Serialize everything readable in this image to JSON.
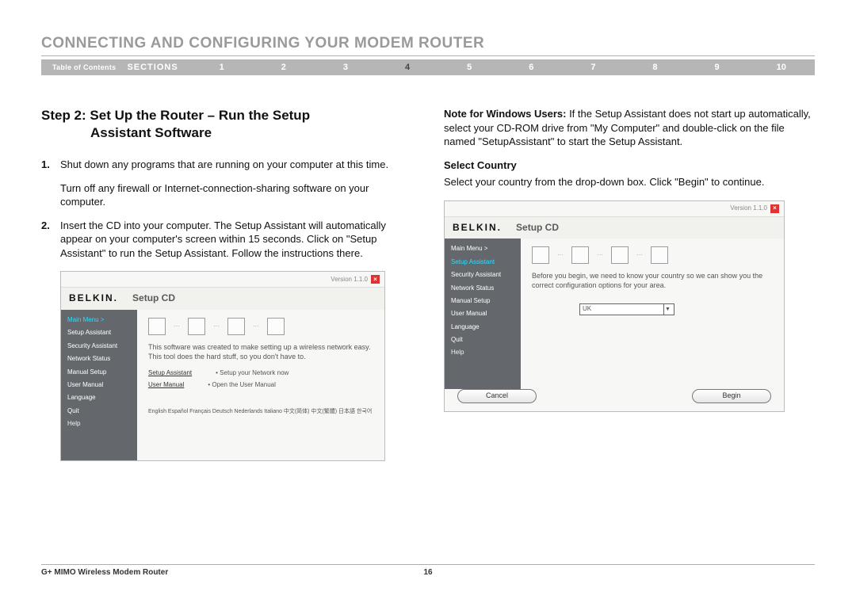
{
  "doc_title": "CONNECTING AND CONFIGURING YOUR MODEM ROUTER",
  "nav": {
    "toc": "Table of Contents",
    "sections": "SECTIONS",
    "numbers": [
      "1",
      "2",
      "3",
      "4",
      "5",
      "6",
      "7",
      "8",
      "9",
      "10"
    ],
    "active": "4"
  },
  "step": {
    "line1": "Step 2: Set Up the Router – Run the Setup",
    "line2": "Assistant Software"
  },
  "list": {
    "n1": "1.",
    "t1": "Shut down any programs that are running on your computer at this time.",
    "sub1": "Turn off any firewall or Internet-connection-sharing software on your computer.",
    "n2": "2.",
    "t2": "Insert the CD into your computer. The Setup Assistant will automatically appear on your computer's screen within 15 seconds. Click on \"Setup Assistant\" to run the Setup Assistant. Follow the instructions there."
  },
  "right": {
    "note_label": "Note for Windows Users:",
    "note_text": " If the Setup Assistant does not start up automatically, select your CD-ROM drive from \"My Computer\" and double-click on the file named \"SetupAssistant\" to start the Setup Assistant.",
    "sc_title": "Select Country",
    "sc_text": "Select your country from the drop-down box. Click \"Begin\" to continue."
  },
  "shotA": {
    "version": "Version 1.1.0",
    "brand": "BELKIN",
    "subhdr": "Setup CD",
    "menu": [
      "Main Menu  >",
      "Setup Assistant",
      "Security Assistant",
      "Network Status",
      "Manual Setup",
      "User Manual",
      "Language",
      "Quit"
    ],
    "highlight": 0,
    "help": "Help",
    "desc": "This software was created to make setting up a wireless network easy. This tool does the hard stuff, so you don't have to.",
    "link1a": "Setup Assistant",
    "link1b": "• Setup your Network now",
    "link2a": "User Manual",
    "link2b": "• Open the User Manual",
    "langs": "English  Español  Français  Deutsch  Nederlands  Italiano  中文(简体)  中文(繁體)  日本語  한국어"
  },
  "shotB": {
    "version": "Version 1.1.0",
    "brand": "BELKIN",
    "subhdr": "Setup CD",
    "menu": [
      "Main Menu  >",
      "Setup Assistant",
      "Security Assistant",
      "Network Status",
      "Manual Setup",
      "User Manual",
      "Language",
      "Quit"
    ],
    "highlight": 1,
    "help": "Help",
    "seltext": "Before you begin, we need to know your country so we can show you the correct configuration options for your area.",
    "dropdown": "UK",
    "btn_cancel": "Cancel",
    "btn_begin": "Begin"
  },
  "footer": {
    "product": "G+ MIMO Wireless Modem Router",
    "page": "16"
  }
}
